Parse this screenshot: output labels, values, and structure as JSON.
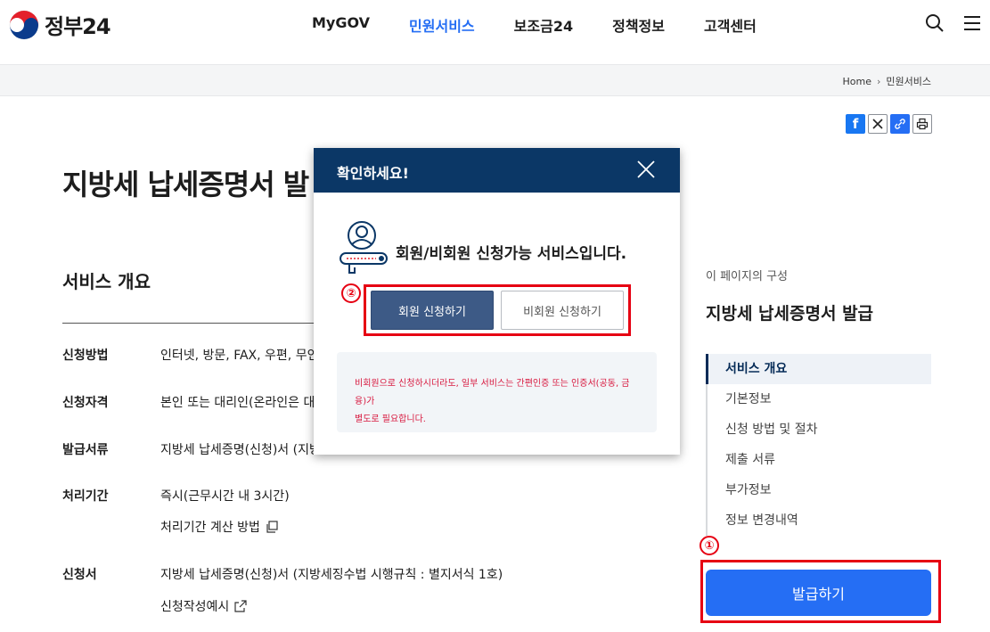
{
  "header": {
    "logo_text": "정부24",
    "nav": [
      {
        "label": "MyGOV",
        "active": false
      },
      {
        "label": "민원서비스",
        "active": true
      },
      {
        "label": "보조금24",
        "active": false
      },
      {
        "label": "정책정보",
        "active": false
      },
      {
        "label": "고객센터",
        "active": false
      }
    ]
  },
  "breadcrumb": {
    "home": "Home",
    "current": "민원서비스"
  },
  "main": {
    "title": "지방세 납세증명서 발",
    "section_title": "서비스 개요",
    "rows": [
      {
        "label": "신청방법",
        "value": "인터넷, 방문, FAX, 우편, 무인"
      },
      {
        "label": "신청자격",
        "value": "본인 또는 대리인(온라인은 대리"
      },
      {
        "label": "발급서류",
        "value": "지방세 납세증명(신청)서 (지방"
      },
      {
        "label": "처리기간",
        "value": "즉시(근무시간 내 3시간)",
        "sub": "처리기간 계산 방법"
      },
      {
        "label": "신청서",
        "value": "지방세 납세증명(신청)서 (지방세징수법 시행규칙 : 별지서식 1호)",
        "sub": "신청작성예시"
      }
    ]
  },
  "toc": {
    "caption": "이 페이지의 구성",
    "title": "지방세 납세증명서 발급",
    "items": [
      "서비스 개요",
      "기본정보",
      "신청 방법 및 절차",
      "제출 서류",
      "부가정보",
      "정보 변경내역"
    ],
    "active_index": 0
  },
  "issue_button": "발급하기",
  "annotations": {
    "one": "①",
    "two": "②"
  },
  "modal": {
    "title": "확인하세요!",
    "message": "회원/비회원 신청가능 서비스입니다.",
    "member_button": "회원 신청하기",
    "nonmember_button": "비회원 신청하기",
    "notice_line1": "비회원으로 신청하시더라도, 일부 서비스는 간편인증 또는 인증서(공동, 금융)가",
    "notice_line2": "별도로 필요합니다."
  },
  "colors": {
    "primary": "#256ef4",
    "navy": "#0b3766",
    "highlight": "#e60012",
    "notice": "#d8193f"
  }
}
